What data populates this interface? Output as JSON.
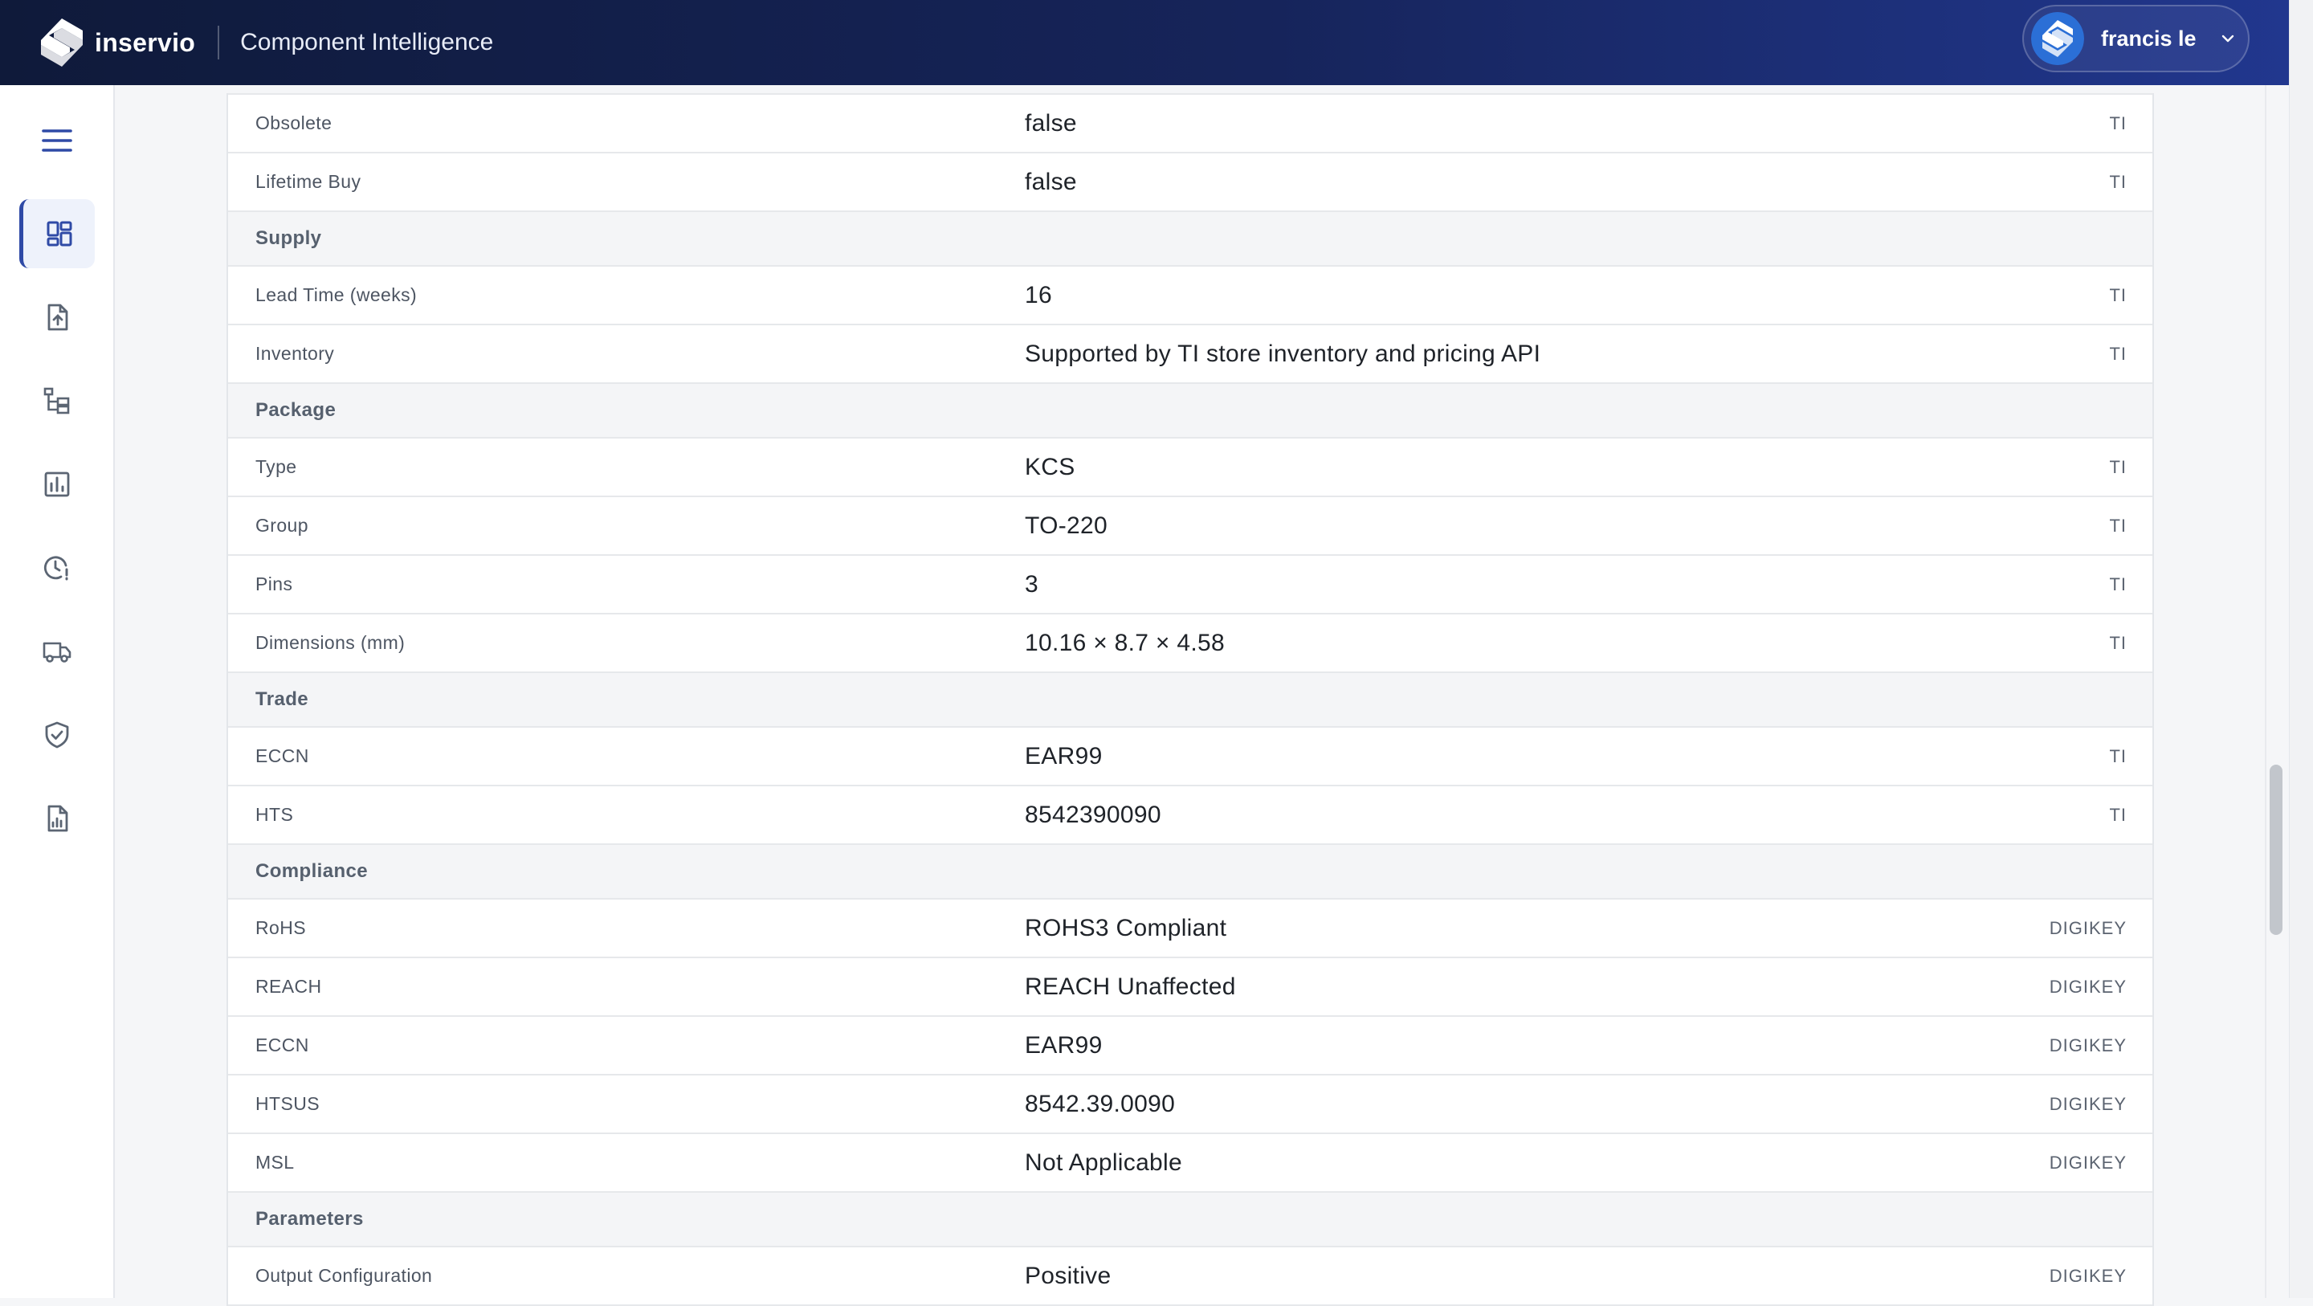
{
  "header": {
    "brand": "inservio",
    "app_title": "Component Intelligence",
    "user_name": "francis le",
    "colors": {
      "bar_start": "#0f1a3a",
      "bar_end": "#21378e",
      "accent": "#2f4aa6"
    }
  },
  "sidebar": {
    "menu_icon": "hamburger-menu-icon",
    "items": [
      {
        "icon": "dashboard-icon",
        "active": true
      },
      {
        "icon": "file-upload-icon",
        "active": false
      },
      {
        "icon": "hierarchy-tree-icon",
        "active": false
      },
      {
        "icon": "bar-chart-icon",
        "active": false
      },
      {
        "icon": "clock-alert-icon",
        "active": false
      },
      {
        "icon": "truck-icon",
        "active": false
      },
      {
        "icon": "shield-check-icon",
        "active": false
      },
      {
        "icon": "report-file-icon",
        "active": false
      }
    ]
  },
  "table": {
    "rows": [
      {
        "type": "row",
        "label": "Obsolete",
        "value": "false",
        "source": "TI"
      },
      {
        "type": "row",
        "label": "Lifetime Buy",
        "value": "false",
        "source": "TI"
      },
      {
        "type": "section",
        "label": "Supply"
      },
      {
        "type": "row",
        "label": "Lead Time (weeks)",
        "value": "16",
        "source": "TI"
      },
      {
        "type": "row",
        "label": "Inventory",
        "value": "Supported by TI store inventory and pricing API",
        "source": "TI"
      },
      {
        "type": "section",
        "label": "Package"
      },
      {
        "type": "row",
        "label": "Type",
        "value": "KCS",
        "source": "TI"
      },
      {
        "type": "row",
        "label": "Group",
        "value": "TO-220",
        "source": "TI"
      },
      {
        "type": "row",
        "label": "Pins",
        "value": "3",
        "source": "TI"
      },
      {
        "type": "row",
        "label": "Dimensions (mm)",
        "value": "10.16 × 8.7 × 4.58",
        "source": "TI"
      },
      {
        "type": "section",
        "label": "Trade"
      },
      {
        "type": "row",
        "label": "ECCN",
        "value": "EAR99",
        "source": "TI"
      },
      {
        "type": "row",
        "label": "HTS",
        "value": "8542390090",
        "source": "TI"
      },
      {
        "type": "section",
        "label": "Compliance"
      },
      {
        "type": "row",
        "label": "RoHS",
        "value": "ROHS3 Compliant",
        "source": "DIGIKEY"
      },
      {
        "type": "row",
        "label": "REACH",
        "value": "REACH Unaffected",
        "source": "DIGIKEY"
      },
      {
        "type": "row",
        "label": "ECCN",
        "value": "EAR99",
        "source": "DIGIKEY"
      },
      {
        "type": "row",
        "label": "HTSUS",
        "value": "8542.39.0090",
        "source": "DIGIKEY"
      },
      {
        "type": "row",
        "label": "MSL",
        "value": "Not Applicable",
        "source": "DIGIKEY"
      },
      {
        "type": "section",
        "label": "Parameters"
      },
      {
        "type": "row",
        "label": "Output Configuration",
        "value": "Positive",
        "source": "DIGIKEY"
      }
    ]
  }
}
